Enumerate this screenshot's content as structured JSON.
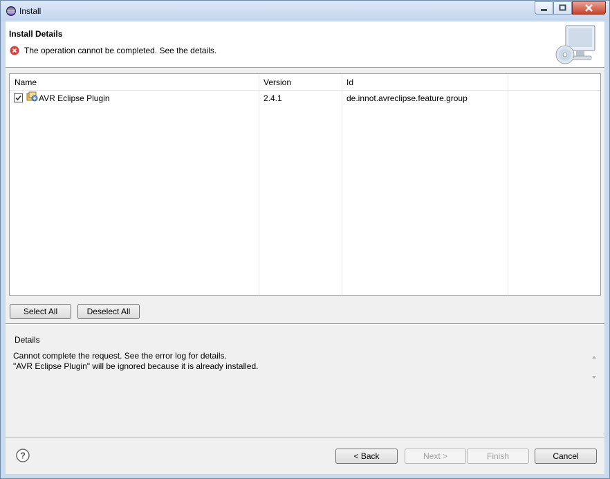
{
  "window": {
    "title": "Install"
  },
  "header": {
    "title": "Install Details",
    "message": "The operation cannot be completed.  See the details."
  },
  "table": {
    "columns": [
      "Name",
      "Version",
      "Id"
    ],
    "rows": [
      {
        "checked": true,
        "name": "AVR Eclipse Plugin",
        "version": "2.4.1",
        "id": "de.innot.avreclipse.feature.group"
      }
    ]
  },
  "selection_buttons": {
    "select_all": "Select All",
    "deselect_all": "Deselect All"
  },
  "details": {
    "label": "Details",
    "lines": [
      "Cannot complete the request.  See the error log for details.",
      "\"AVR Eclipse Plugin\" will be ignored because it is already installed."
    ]
  },
  "footer": {
    "back": "< Back",
    "next": "Next >",
    "finish": "Finish",
    "cancel": "Cancel"
  },
  "colors": {
    "error": "#d9403a",
    "window_frame": "#c9daee",
    "client_bg": "#f0f0f0"
  }
}
